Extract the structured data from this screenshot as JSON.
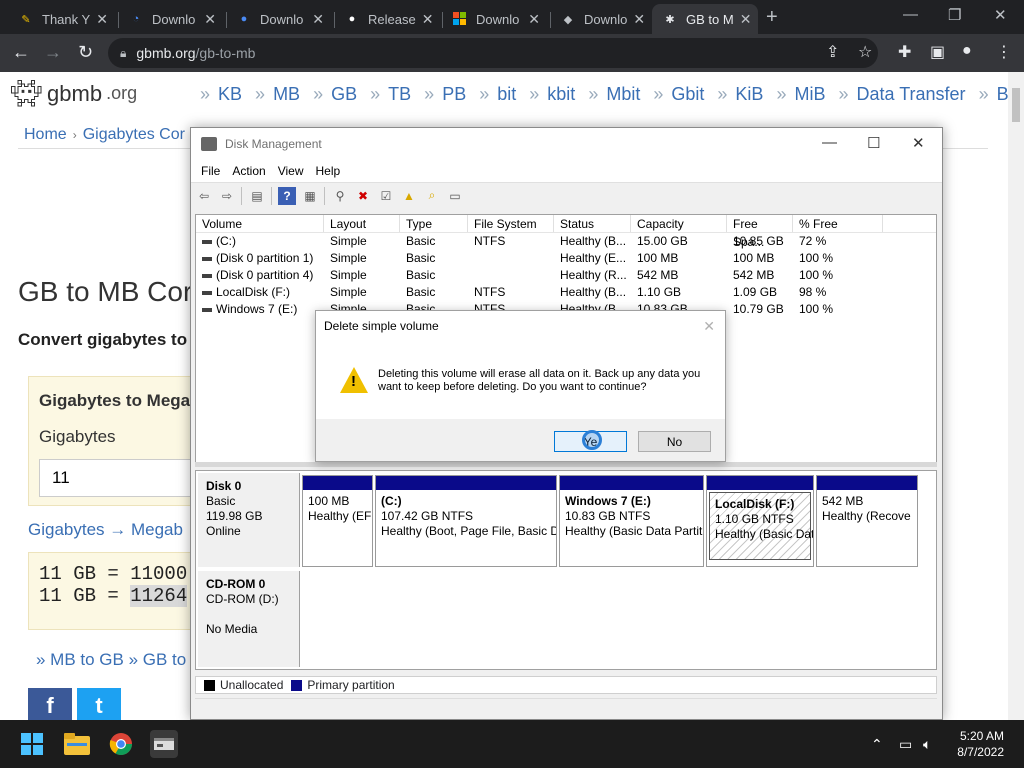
{
  "browser": {
    "tabs": [
      {
        "label": "Thank Y",
        "icon": "wrench-icon",
        "color": "#f0c000"
      },
      {
        "label": "Downlo",
        "icon": "loading-icon",
        "color": "#4a8af4"
      },
      {
        "label": "Downlo",
        "icon": "globe-icon",
        "color": "#4a8af4"
      },
      {
        "label": "Release",
        "icon": "github-icon",
        "color": "#ffffff"
      },
      {
        "label": "Downlo",
        "icon": "windows-logo-icon",
        "color": "#f25022"
      },
      {
        "label": "Downlo",
        "icon": "app-icon",
        "color": "#bdc1c6"
      },
      {
        "label": "GB to M",
        "icon": "gbmb-icon",
        "color": "#bdc1c6"
      }
    ],
    "url_host": "gbmb.org",
    "url_path": "/gb-to-mb"
  },
  "site": {
    "logo": "gbmb",
    "logo_tld": ".org",
    "nav": [
      "KB",
      "MB",
      "GB",
      "TB",
      "PB",
      "bit",
      "kbit",
      "Mbit",
      "Gbit",
      "KiB",
      "MiB",
      "Data Transfer",
      "Blog"
    ],
    "nav_sep": "»",
    "breadcrumb_home": "Home",
    "breadcrumb_sep": "›",
    "breadcrumb_current": "Gigabytes Cor",
    "heading": "GB to MB Cor",
    "lead": "Convert gigabytes to",
    "calc_title": "Gigabytes to Mega",
    "calc_label": "Gigabytes",
    "calc_value": "11",
    "conv_link": "Gigabytes → Megab",
    "result_1": "11 GB = 11000",
    "result_2_prefix": "11 GB = ",
    "result_2_value": "11264",
    "more_links": "» MB to GB  » GB to",
    "facebook": "f",
    "twitter": "t"
  },
  "disk_mgmt": {
    "title": "Disk Management",
    "menu": [
      "File",
      "Action",
      "View",
      "Help"
    ],
    "columns": [
      "Volume",
      "Layout",
      "Type",
      "File System",
      "Status",
      "Capacity",
      "Free Spa...",
      "% Free"
    ],
    "volumes": [
      [
        "(C:)",
        "Simple",
        "Basic",
        "NTFS",
        "Healthy (B...",
        "15.00 GB",
        "10.85 GB",
        "72 %"
      ],
      [
        "(Disk 0 partition 1)",
        "Simple",
        "Basic",
        "",
        "Healthy (E...",
        "100 MB",
        "100 MB",
        "100 %"
      ],
      [
        "(Disk 0 partition 4)",
        "Simple",
        "Basic",
        "",
        "Healthy (R...",
        "542 MB",
        "542 MB",
        "100 %"
      ],
      [
        "LocalDisk (F:)",
        "Simple",
        "Basic",
        "NTFS",
        "Healthy (B...",
        "1.10 GB",
        "1.09 GB",
        "98 %"
      ],
      [
        "Windows 7 (E:)",
        "Simple",
        "Basic",
        "NTFS",
        "Healthy (B...",
        "10.83 GB",
        "10.79 GB",
        "100 %"
      ]
    ],
    "disk0": {
      "name": "Disk 0",
      "type": "Basic",
      "size": "119.98 GB",
      "state": "Online"
    },
    "partitions": [
      {
        "name": "",
        "size": "100 MB",
        "status": "Healthy (EFI"
      },
      {
        "name": "(C:)",
        "size": "107.42 GB NTFS",
        "status": "Healthy (Boot, Page File, Basic D"
      },
      {
        "name": "Windows 7  (E:)",
        "size": "10.83 GB NTFS",
        "status": "Healthy (Basic Data Partit"
      },
      {
        "name": "LocalDisk  (F:)",
        "size": "1.10 GB NTFS",
        "status": "Healthy (Basic Dat"
      },
      {
        "name": "",
        "size": "542 MB",
        "status": "Healthy (Recove"
      }
    ],
    "cdrom": {
      "name": "CD-ROM 0",
      "drive": "CD-ROM (D:)",
      "media": "No Media"
    },
    "legend_unallocated": "Unallocated",
    "legend_primary": "Primary partition",
    "unallocated_color": "#000000",
    "primary_color": "#0a0a8a"
  },
  "dialog": {
    "title": "Delete simple volume",
    "message": "Deleting this volume will erase all data on it. Back up any data you want to keep before deleting. Do you want to continue?",
    "yes": "Ye",
    "no": "No"
  },
  "taskbar": {
    "time": "5:20 AM",
    "date": "8/7/2022"
  }
}
